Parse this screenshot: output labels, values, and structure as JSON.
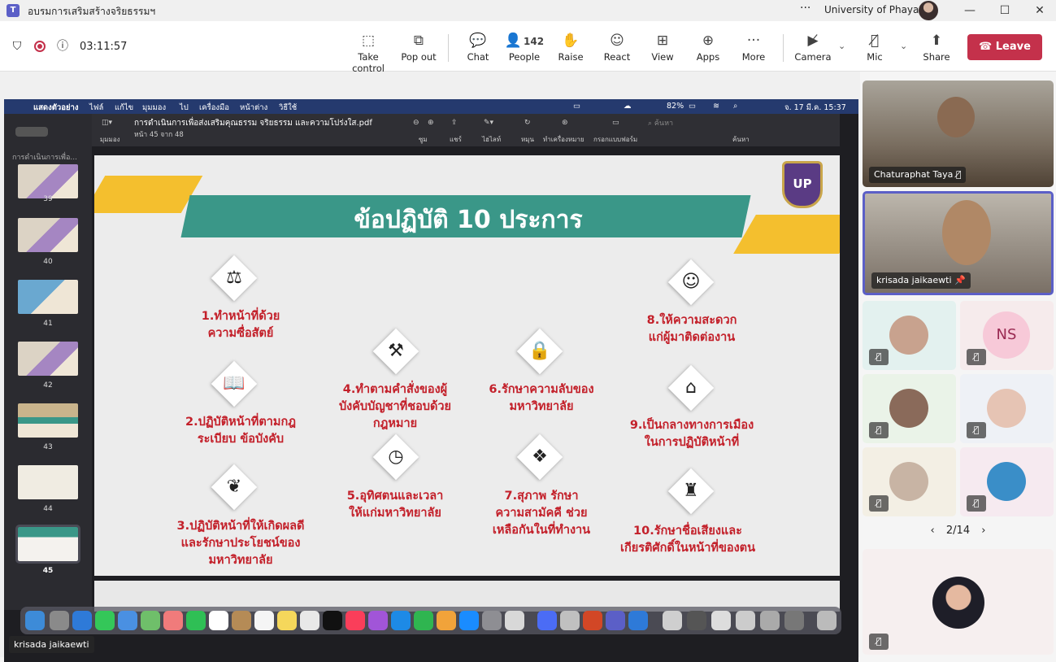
{
  "window": {
    "title": "อบรมการเสริมสร้างจริยธรรมฯ",
    "org": "University of Phayao",
    "more": "···"
  },
  "toolbar": {
    "timer": "03:11:57",
    "take_control": "Take control",
    "pop_out": "Pop out",
    "chat": "Chat",
    "people_count": "142",
    "people": "People",
    "raise": "Raise",
    "react": "React",
    "view": "View",
    "apps": "Apps",
    "more": "More",
    "camera": "Camera",
    "mic": "Mic",
    "share": "Share",
    "leave": "Leave"
  },
  "mac_menu": {
    "app": "แสดงตัวอย่าง",
    "items": [
      "ไฟล์",
      "แก้ไข",
      "มุมมอง",
      "ไป",
      "เครื่องมือ",
      "หน้าต่าง",
      "วิธีใช้"
    ],
    "battery": "82%",
    "clock": "จ. 17 มี.ค. 15:37"
  },
  "pdf": {
    "filename": "การดำเนินการเพื่อส่งเสริมคุณธรรม จริยธรรม และความโปร่งใส.pdf",
    "page_info": "หน้า 45 จาก 48",
    "view_label": "มุมมอง",
    "sidebar_title": "การดำเนินการเพื่อ...",
    "tools": [
      "ซูม",
      "แชร์",
      "ไฮไลท์",
      "หมุน",
      "ทำเครื่องหมาย",
      "กรอกแบบฟอร์ม",
      "ค้นหา"
    ],
    "search_placeholder": "ค้นหา",
    "pages": [
      "39",
      "40",
      "41",
      "42",
      "43",
      "44",
      "45"
    ]
  },
  "slide": {
    "title": "ข้อปฏิบัติ 10 ประการ",
    "logo": "UP",
    "items": [
      {
        "num": "1",
        "l1": "1.ทำหน้าที่ด้วย",
        "l2": "ความซื่อสัตย์",
        "l3": ""
      },
      {
        "num": "2",
        "l1": "2.ปฏิบัติหน้าที่ตามกฎ",
        "l2": "ระเบียบ ข้อบังคับ",
        "l3": ""
      },
      {
        "num": "3",
        "l1": "3.ปฏิบัติหน้าที่ให้เกิดผลดี",
        "l2": "และรักษาประโยชน์ของ",
        "l3": "มหาวิทยาลัย"
      },
      {
        "num": "4",
        "l1": "4.ทำตามคำสั่งของผู้",
        "l2": "บังคับบัญชาที่ชอบด้วย",
        "l3": "กฎหมาย"
      },
      {
        "num": "5",
        "l1": "5.อุทิศตนและเวลา",
        "l2": "ให้แก่มหาวิทยาลัย",
        "l3": ""
      },
      {
        "num": "6",
        "l1": "6.รักษาความลับของ",
        "l2": "มหาวิทยาลัย",
        "l3": ""
      },
      {
        "num": "7",
        "l1": "7.สุภาพ รักษา",
        "l2": "ความสามัคคี ช่วย",
        "l3": "เหลือกันในที่ทำงาน"
      },
      {
        "num": "8",
        "l1": "8.ให้ความสะดวก",
        "l2": "แก่ผู้มาติดต่องาน",
        "l3": ""
      },
      {
        "num": "9",
        "l1": "9.เป็นกลางทางการเมือง",
        "l2": "ในการปฏิบัติหน้าที่",
        "l3": ""
      },
      {
        "num": "10",
        "l1": "10.รักษาชื่อเสียงและ",
        "l2": "เกียรติศักดิ์ในหน้าที่ของตน",
        "l3": ""
      }
    ]
  },
  "presenter": "krisada jaikaewti",
  "participants": {
    "p1": "Chaturaphat Taya",
    "p2": "krisada jaikaewti",
    "initials": "NS",
    "pager": "2/14"
  },
  "colors": {
    "leave": "#c4314b",
    "accent": "#5b5fc7",
    "slide_red": "#c3202a",
    "banner": "#3a9788",
    "yellow": "#f4bf2e"
  }
}
